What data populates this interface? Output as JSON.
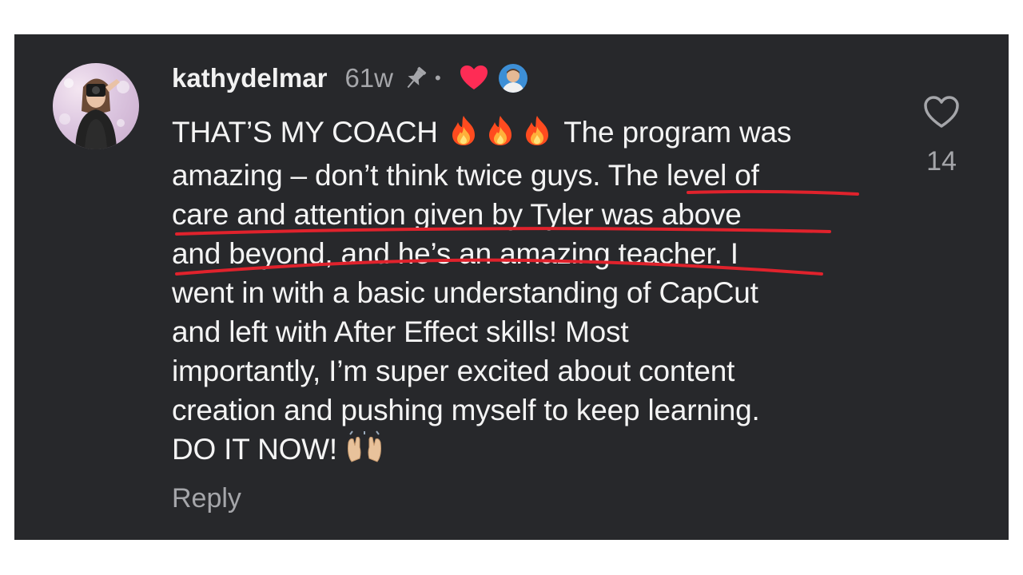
{
  "comment": {
    "username": "kathydelmar",
    "time_ago": "61w",
    "separator": "•",
    "lines": [
      "THAT’S MY COACH",
      "The program was",
      "amazing – don’t think twice guys.",
      "The level of",
      "care and attention given by Tyler was above",
      "and beyond, and he’s an amazing teacher.",
      "I",
      "went in with a basic understanding of CapCut",
      "and left with After Effect skills! Most",
      "importantly, I’m super excited about content",
      "creation and pushing myself to keep learning.",
      "DO IT NOW!"
    ],
    "emojis": {
      "fire": "fire-emoji",
      "raised_hands": "raised-hands-emoji"
    },
    "reply_label": "Reply",
    "like_count": "14"
  },
  "icons": {
    "pin": "pin-icon",
    "creator_heart": "heart-icon",
    "creator_avatar": "creator-avatar",
    "like": "heart-outline-icon"
  },
  "colors": {
    "background": "#27282b",
    "text": "#f4f4f4",
    "muted": "#a5a6aa",
    "heart_red": "#fe2c55",
    "underline_red": "#e0222c"
  }
}
